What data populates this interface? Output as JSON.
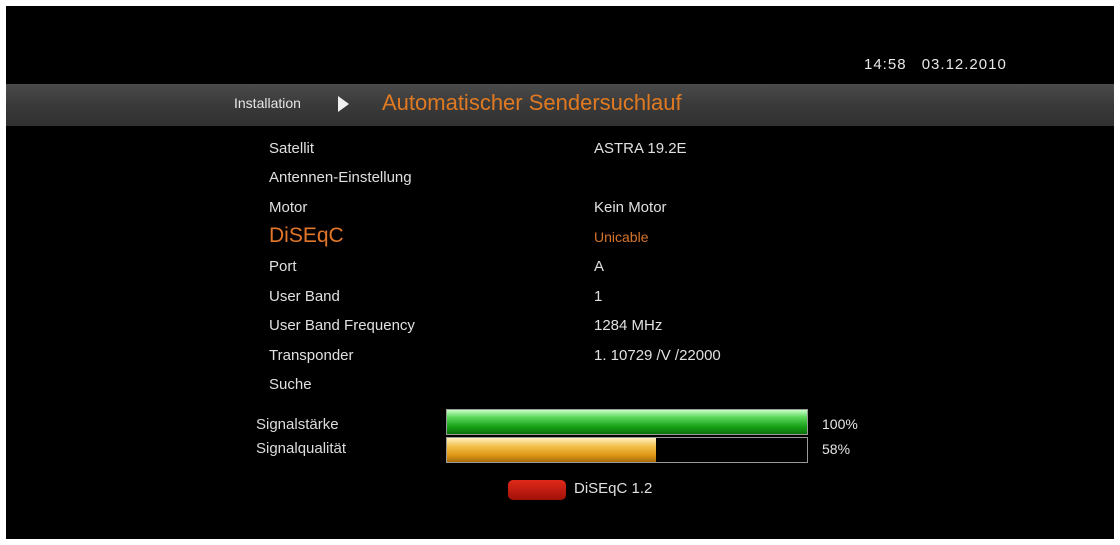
{
  "clock": {
    "time": "14:58",
    "date": "03.12.2010"
  },
  "header": {
    "breadcrumb": "Installation",
    "title": "Automatischer Sendersuchlauf"
  },
  "menu": {
    "satellite": {
      "label": "Satellit",
      "value": "ASTRA 19.2E"
    },
    "antenna": {
      "label": "Antennen-Einstellung"
    },
    "motor": {
      "label": "Motor",
      "value": "Kein Motor"
    },
    "diseqc": {
      "label": "DiSEqC",
      "value": "Unicable"
    },
    "port": {
      "label": "Port",
      "value": "A"
    },
    "user_band": {
      "label": "User Band",
      "value": "1"
    },
    "user_band_frequency": {
      "label": "User Band Frequency",
      "value": "1284 MHz"
    },
    "transponder": {
      "label": "Transponder",
      "value": "1. 10729 /V /22000"
    },
    "search": {
      "label": "Suche"
    }
  },
  "signal": {
    "strength": {
      "label": "Signalstärke",
      "percent": 100,
      "percent_text": "100%"
    },
    "quality": {
      "label": "Signalqualität",
      "percent": 58,
      "percent_text": "58%"
    }
  },
  "footer": {
    "red_key_label": "DiSEqC 1.2"
  },
  "colors": {
    "accent": "#e07a22",
    "strength_bar": "#22b022",
    "quality_bar": "#e8a020",
    "red_key": "#c01a10"
  }
}
